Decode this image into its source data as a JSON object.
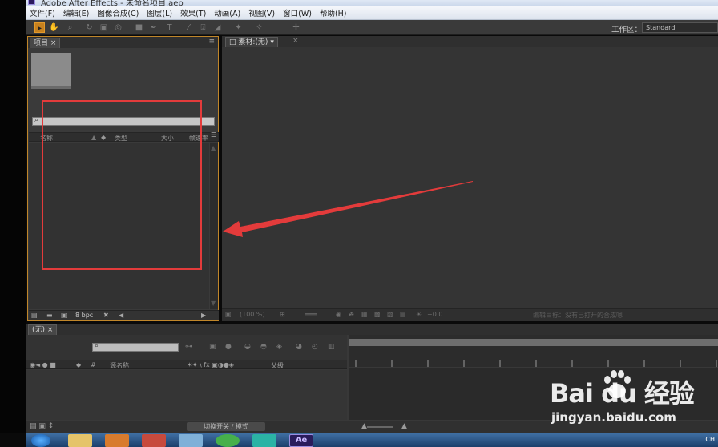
{
  "window": {
    "title": "Adobe After Effects - 未命名项目.aep"
  },
  "menu": [
    "文件(F)",
    "编辑(E)",
    "图像合成(C)",
    "图层(L)",
    "效果(T)",
    "动画(A)",
    "视图(V)",
    "窗口(W)",
    "帮助(H)"
  ],
  "toolbar": {
    "workspace_label": "工作区：",
    "workspace_value": "Standard"
  },
  "project_panel": {
    "tab": "项目",
    "columns": {
      "name": "名称",
      "type": "类型",
      "size": "大小",
      "duration": "帧速率"
    },
    "bpc": "8 bpc"
  },
  "viewer_panel": {
    "tab": "素材:(无)",
    "zoom": "(100 %)",
    "status": "编辑目标：没有已打开的合成嗯",
    "exposure": "+0.0"
  },
  "timeline_panel": {
    "tab": "(无)",
    "layer_name_header": "源名称",
    "parent_header": "父级",
    "toggle_label": "切换开关 / 模式"
  },
  "watermark": {
    "logo": "Bai du 经验",
    "url": "jingyan.baidu.com"
  },
  "taskbar": {
    "clock": "CH"
  },
  "colors": {
    "annotation": "#e33b3b",
    "panel_highlight": "#c0862a",
    "toolbar_active": "#c7811e"
  }
}
